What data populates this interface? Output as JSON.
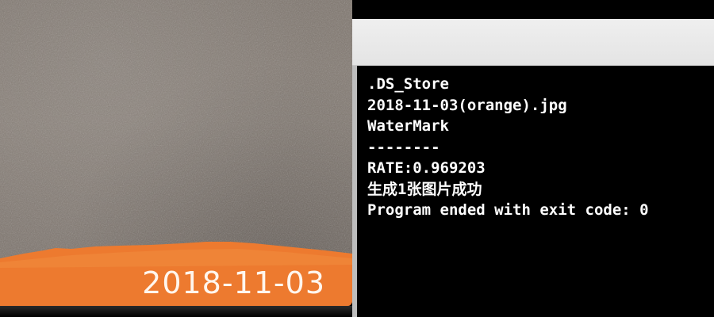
{
  "photo": {
    "date_stamp": "2018-11-03",
    "watermark_color": "#ed7a2f",
    "surface_color": "#7f766e"
  },
  "console": {
    "background": "#000000",
    "text_color": "#ffffff",
    "lines": [
      ".DS_Store",
      "2018-11-03(orange).jpg",
      "WaterMark",
      "--------",
      "RATE:0.969203",
      "生成1张图片成功",
      "Program ended with exit code: 0"
    ]
  }
}
